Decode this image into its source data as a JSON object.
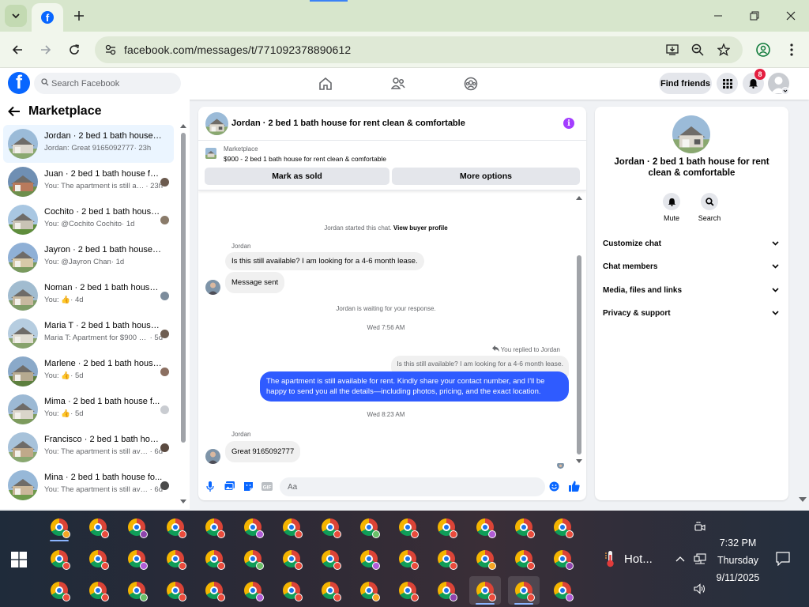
{
  "browser": {
    "url": "facebook.com/messages/t/771092378890612"
  },
  "facebook": {
    "search_placeholder": "Search Facebook",
    "find_friends_label": "Find friends",
    "notification_count": "8"
  },
  "sidebar": {
    "title": "Marketplace",
    "conversations": [
      {
        "title": "Jordan · 2 bed 1 bath house for...",
        "preview": "Jordan: Great 9165092777",
        "time": " · 23h",
        "active": true
      },
      {
        "title": "Juan · 2 bed 1 bath house for...",
        "preview": "You: The apartment is still avai...",
        "time": " · 23h"
      },
      {
        "title": "Cochito · 2 bed 1 bath house fo...",
        "preview": "You: @Cochito Cochito",
        "time": " · 1d"
      },
      {
        "title": "Jayron · 2 bed 1 bath house for ...",
        "preview": "You: @Jayron Chan",
        "time": " · 1d"
      },
      {
        "title": "Noman · 2 bed 1 bath house ...",
        "preview": "You: 👍",
        "time": " · 4d"
      },
      {
        "title": "Maria T · 2 bed 1 bath house fo...",
        "preview": "Maria T: Apartment for $900 hund...",
        "time": " · 5d"
      },
      {
        "title": "Marlene · 2 bed 1 bath house...",
        "preview": "You: 👍",
        "time": " · 5d"
      },
      {
        "title": "Mima · 2 bed 1 bath house f...",
        "preview": "You: 👍",
        "time": " · 5d"
      },
      {
        "title": "Francisco · 2 bed 1 bath hous...",
        "preview": "You: The apartment is still avail...",
        "time": " · 6d"
      },
      {
        "title": "Mina · 2 bed 1 bath house fo...",
        "preview": "You: The apartment is still avail...",
        "time": " · 6d"
      }
    ]
  },
  "chat": {
    "title": "Jordan · 2 bed 1 bath house for rent clean & comfortable",
    "listing_label": "Marketplace",
    "listing_desc": "$900 - 2 bed 1 bath house for rent clean & comfortable",
    "mark_sold_label": "Mark as sold",
    "more_options_label": "More options",
    "started_text": "Jordan started this chat.",
    "view_profile_link": "View buyer profile",
    "sender_name_1": "Jordan",
    "msg_1": "Is this still available? I am looking for a 4-6 month lease.",
    "msg_2": "Message sent",
    "waiting_text": "Jordan is waiting for your response.",
    "timestamp_1": "Wed 7:56 AM",
    "replied_label": "You replied to Jordan",
    "quoted_msg": "Is this still available? I am looking for a 4-6 month lease.",
    "reply_msg": "The apartment is still available for rent. Kindly share your contact number, and I'll be happy to send you all the details—including photos, pricing, and the exact location.",
    "timestamp_2": "Wed 8:23 AM",
    "sender_name_2": "Jordan",
    "msg_3": "Great 9165092777",
    "composer_placeholder": "Aa"
  },
  "info_panel": {
    "title": "Jordan · 2 bed 1 bath house for rent clean & comfortable",
    "mute_label": "Mute",
    "search_label": "Search",
    "sections": [
      "Customize chat",
      "Chat members",
      "Media, files and links",
      "Privacy & support"
    ]
  },
  "taskbar": {
    "weather_text": "Hot...",
    "time": "7:32 PM",
    "day": "Thursday",
    "date": "9/11/2025"
  },
  "colors": {
    "facebook_blue": "#0866ff",
    "chrome_frame": "#d7e6cc",
    "outgoing_bubble": "#2f5bff",
    "info_purple": "#a33dff",
    "badge_red": "#e41e3f"
  }
}
